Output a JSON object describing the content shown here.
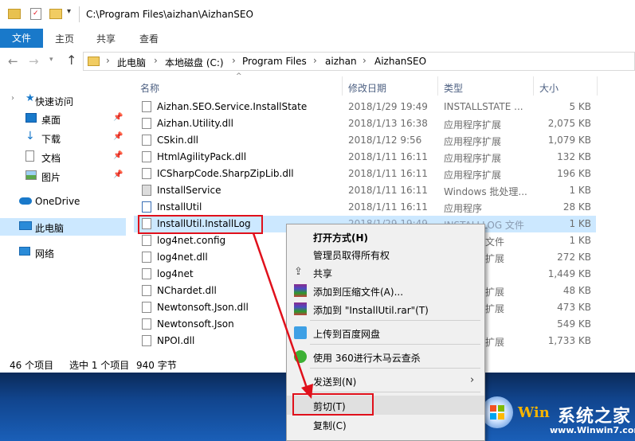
{
  "window": {
    "title": "C:\\Program Files\\aizhan\\AizhanSEO"
  },
  "ribbon": {
    "tabs": [
      "文件",
      "主页",
      "共享",
      "查看"
    ]
  },
  "address": {
    "crumbs": [
      "此电脑",
      "本地磁盘 (C:)",
      "Program Files",
      "aizhan",
      "AizhanSEO"
    ]
  },
  "nav": {
    "items": [
      {
        "label": "快速访问",
        "icon": "star-icon"
      },
      {
        "label": "桌面",
        "icon": "desktop-icon",
        "pinned": true
      },
      {
        "label": "下载",
        "icon": "download-icon",
        "pinned": true
      },
      {
        "label": "文档",
        "icon": "document-icon",
        "pinned": true
      },
      {
        "label": "图片",
        "icon": "picture-icon",
        "pinned": true
      },
      {
        "label": "OneDrive",
        "icon": "cloud-icon"
      },
      {
        "label": "此电脑",
        "icon": "computer-icon",
        "selected": true
      },
      {
        "label": "网络",
        "icon": "network-icon"
      }
    ]
  },
  "columns": {
    "name": "名称",
    "date": "修改日期",
    "type": "类型",
    "size": "大小"
  },
  "files": [
    {
      "name": "Aizhan.SEO.Service.InstallState",
      "date": "2018/1/29 19:49",
      "type": "INSTALLSTATE ...",
      "size": "5 KB"
    },
    {
      "name": "Aizhan.Utility.dll",
      "date": "2018/1/13 16:38",
      "type": "应用程序扩展",
      "size": "2,075 KB"
    },
    {
      "name": "CSkin.dll",
      "date": "2018/1/12 9:56",
      "type": "应用程序扩展",
      "size": "1,079 KB"
    },
    {
      "name": "HtmlAgilityPack.dll",
      "date": "2018/1/11 16:11",
      "type": "应用程序扩展",
      "size": "132 KB"
    },
    {
      "name": "ICSharpCode.SharpZipLib.dll",
      "date": "2018/1/11 16:11",
      "type": "应用程序扩展",
      "size": "196 KB"
    },
    {
      "name": "InstallService",
      "date": "2018/1/11 16:11",
      "type": "Windows 批处理...",
      "size": "1 KB"
    },
    {
      "name": "InstallUtil",
      "date": "2018/1/11 16:11",
      "type": "应用程序",
      "size": "28 KB"
    },
    {
      "name": "InstallUtil.InstallLog",
      "date": "2018/1/29 19:49",
      "type": "INSTALLLOG 文件",
      "size": "1 KB"
    },
    {
      "name": "log4net.config",
      "date": "",
      "type": "文件",
      "size": "1 KB"
    },
    {
      "name": "log4net.dll",
      "date": "",
      "type": "扩展",
      "size": "272 KB"
    },
    {
      "name": "log4net",
      "date": "",
      "type": "",
      "size": "1,449 KB"
    },
    {
      "name": "NChardet.dll",
      "date": "",
      "type": "扩展",
      "size": "48 KB"
    },
    {
      "name": "Newtonsoft.Json.dll",
      "date": "",
      "type": "扩展",
      "size": "473 KB"
    },
    {
      "name": "Newtonsoft.Json",
      "date": "",
      "type": "",
      "size": "549 KB"
    },
    {
      "name": "NPOI.dll",
      "date": "",
      "type": "扩展",
      "size": "1,733 KB"
    }
  ],
  "status": {
    "count": "46 个项目",
    "selected": "选中 1 个项目",
    "size": "940 字节"
  },
  "context_menu": {
    "items": [
      {
        "label": "打开方式(H)",
        "bold": true
      },
      {
        "label": "管理员取得所有权"
      },
      {
        "label": "共享",
        "icon": "share-icon"
      },
      {
        "label": "添加到压缩文件(A)...",
        "icon": "winrar-icon"
      },
      {
        "label": "添加到 \"InstallUtil.rar\"(T)",
        "icon": "winrar-icon"
      },
      {
        "label": "上传到百度网盘",
        "icon": "baidu-cloud-icon"
      },
      {
        "label": "使用 360进行木马云查杀",
        "icon": "360-icon"
      },
      {
        "label": "发送到(N)",
        "submenu": true
      },
      {
        "label": "剪切(T)",
        "highlighted": true
      },
      {
        "label": "复制(C)"
      }
    ]
  },
  "watermark": {
    "logo": "Win",
    "text": "系统之家",
    "url": "www.Winwin7.com"
  },
  "colors": {
    "accent": "#1979ca",
    "selection": "#cce8ff",
    "annotation": "#e0101b"
  }
}
